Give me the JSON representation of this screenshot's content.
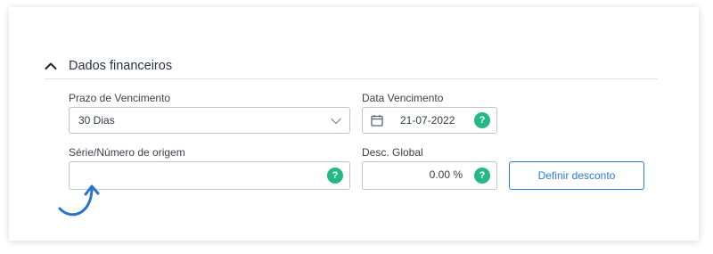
{
  "section": {
    "title": "Dados financeiros"
  },
  "form": {
    "prazo_label": "Prazo de Vencimento",
    "prazo_value": "30 Dias",
    "data_label": "Data Vencimento",
    "data_value": "21-07-2022",
    "serie_label": "Série/Número de origem",
    "serie_value": "",
    "desc_label": "Desc. Global",
    "desc_value": "0.00 %",
    "help_glyph": "?",
    "define_button": "Definir desconto"
  },
  "icons": {
    "section_toggle": "chevron-up-icon",
    "select": "chevron-down-icon",
    "date": "calendar-icon",
    "help": "question-icon",
    "annotation": "curved-arrow-icon"
  },
  "colors": {
    "help_badge": "#26b884",
    "accent": "#2d7ad6",
    "field_border": "#bcc5d1"
  }
}
